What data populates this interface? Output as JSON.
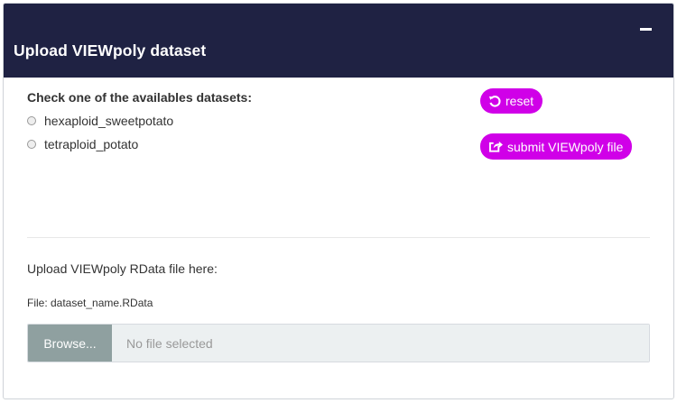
{
  "panel": {
    "title": "Upload VIEWpoly dataset",
    "collapse_icon": "minus-icon"
  },
  "datasets": {
    "label": "Check one of the availables datasets:",
    "options": [
      "hexaploid_sweetpotato",
      "tetraploid_potato"
    ],
    "selected": null
  },
  "buttons": {
    "reset_label": "reset",
    "reset_icon": "undo-icon",
    "submit_label": "submit VIEWpoly file",
    "submit_icon": "share-square-icon",
    "accent_color": "#d000e8"
  },
  "upload": {
    "label": "Upload VIEWpoly RData file here:",
    "file_note": "File: dataset_name.RData",
    "browse_label": "Browse...",
    "placeholder": "No file selected"
  },
  "colors": {
    "header_bg": "#1f2243",
    "browse_bg": "#8fa0a0"
  }
}
